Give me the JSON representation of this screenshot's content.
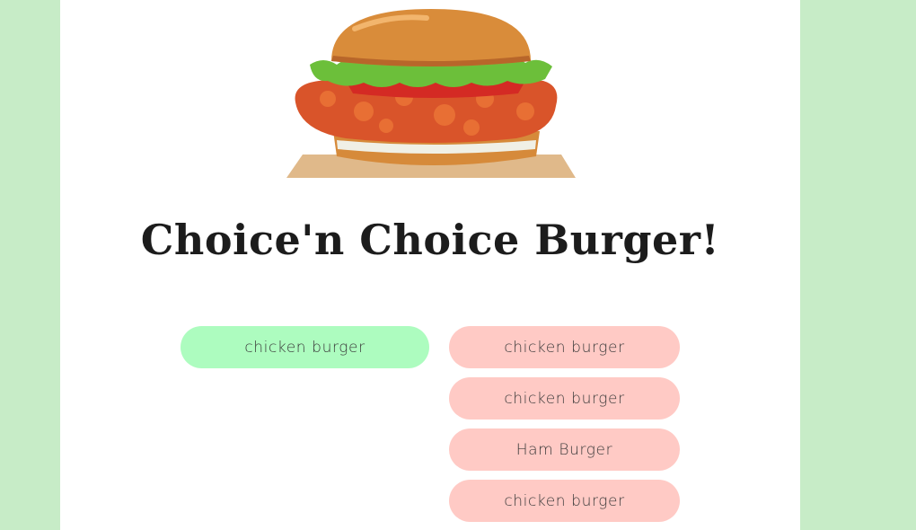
{
  "app": {
    "title": "Choice'n Choice Burger!"
  },
  "hero_image": {
    "icon": "chicken-burger-icon"
  },
  "choices": {
    "selected": {
      "label": "chicken burger",
      "color": "#adfcbf"
    },
    "options": [
      {
        "label": "chicken burger",
        "color": "#ffcac5"
      },
      {
        "label": "chicken burger",
        "color": "#ffcac5"
      },
      {
        "label": "Ham Burger",
        "color": "#ffcac5"
      },
      {
        "label": "chicken burger",
        "color": "#ffcac5"
      }
    ]
  },
  "colors": {
    "page_background": "#c7ecc7",
    "card_background": "#ffffff",
    "title_text": "#1c1c1c"
  }
}
